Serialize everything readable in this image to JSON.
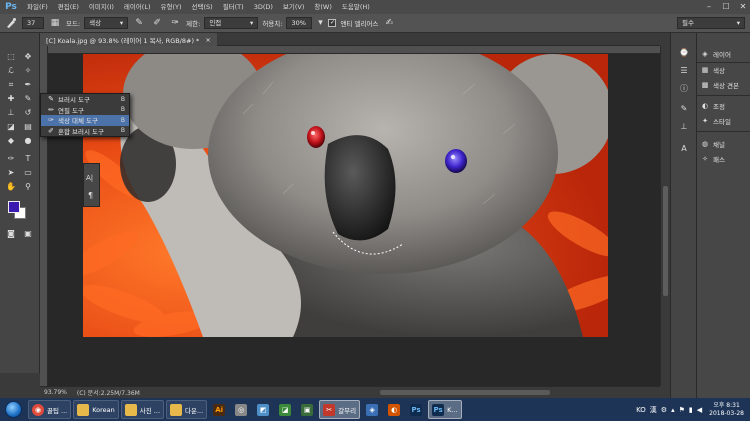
{
  "app": {
    "logo": "Ps"
  },
  "menu": {
    "items": [
      "파일(F)",
      "편집(E)",
      "이미지(I)",
      "레이어(L)",
      "유형(Y)",
      "선택(S)",
      "필터(T)",
      "3D(D)",
      "보기(V)",
      "창(W)",
      "도움말(H)"
    ]
  },
  "window_controls": {
    "minimize": "–",
    "maximize": "☐",
    "close": "✕"
  },
  "options": {
    "brush_size": "37",
    "mode_label": "모드:",
    "mode_value": "색상",
    "limit_label": "제한:",
    "limit_value": "인접",
    "tolerance_label": "허용치:",
    "tolerance_value": "30%",
    "antialias_label": "앤티 앨리어스",
    "antialias_checked": "✓",
    "workspace_value": "필수"
  },
  "document": {
    "tab_title": "[C] Koala.jpg @ 93.8% (레이어 1 복사, RGB/8#) *",
    "tab_close": "×"
  },
  "flyout": {
    "items": [
      {
        "label": "브러시 도구",
        "key": "B"
      },
      {
        "label": "연필 도구",
        "key": "B"
      },
      {
        "label": "색상 대체 도구",
        "key": "B"
      },
      {
        "label": "혼합 브러시 도구",
        "key": "B"
      }
    ]
  },
  "mini_panel": {
    "char_label": "A|",
    "para_label": "¶"
  },
  "status": {
    "zoom": "93.79%",
    "doc_info": "(C) 문서:2.25M/7.36M"
  },
  "side_panels": {
    "items": [
      "레이어",
      "색상",
      "색상 견본",
      "조정",
      "스타일",
      "채널",
      "패스"
    ]
  },
  "taskbar": {
    "buttons": [
      {
        "label": "꿀팁 ...",
        "icon": "chrome-icon",
        "color": "#e04b3b"
      },
      {
        "label": "Korean",
        "icon": "folder-icon",
        "color": "#e7b94a"
      },
      {
        "label": "사진 ...",
        "icon": "folder-icon",
        "color": "#e7b94a"
      },
      {
        "label": "다운...",
        "icon": "folder-icon",
        "color": "#e7b94a"
      },
      {
        "label": "",
        "icon": "illustrator-icon",
        "color": "#4a2b12"
      },
      {
        "label": "",
        "icon": "app-icon",
        "color": "#888888"
      },
      {
        "label": "",
        "icon": "app-icon",
        "color": "#4f8fc7"
      },
      {
        "label": "",
        "icon": "app-icon",
        "color": "#3b8a3b"
      },
      {
        "label": "",
        "icon": "app-icon",
        "color": "#3a6b3a"
      },
      {
        "label": "갈무리",
        "icon": "capture-icon",
        "color": "#c0392b"
      },
      {
        "label": "",
        "icon": "app-icon",
        "color": "#3b6fb5"
      },
      {
        "label": "",
        "icon": "app-icon",
        "color": "#d35400"
      },
      {
        "label": "",
        "icon": "photoshop-icon",
        "color": "#0f2b4d"
      },
      {
        "label": "K...",
        "icon": "photoshop-icon",
        "color": "#0f2b4d"
      }
    ],
    "tray": {
      "lang": "KO",
      "ime": "漢",
      "time": "오후 8:31",
      "date": "2018-03-28"
    }
  },
  "colors": {
    "foreground": "#3c1cb0",
    "background": "#ffffff",
    "selection": "#4b73a9"
  }
}
